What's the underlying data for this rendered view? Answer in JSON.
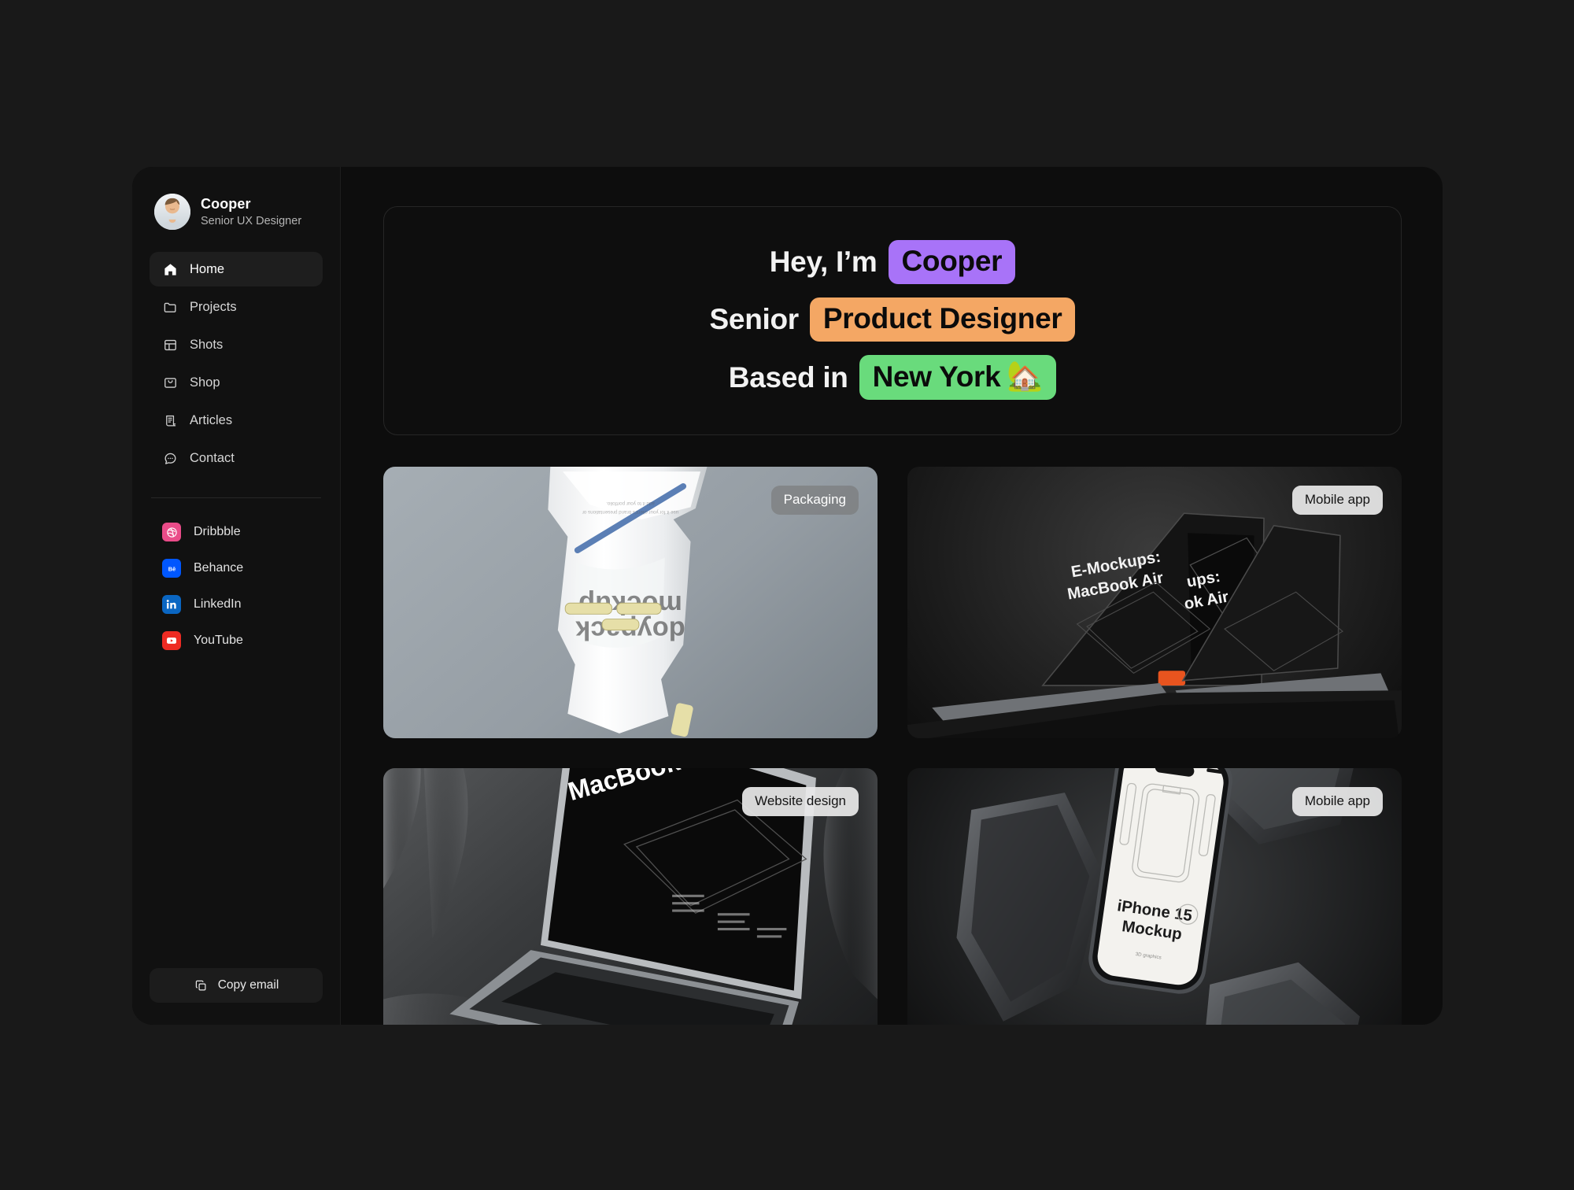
{
  "profile": {
    "name": "Cooper",
    "role": "Senior UX Designer",
    "avatar_icon": "user-avatar-photo"
  },
  "nav": {
    "items": [
      {
        "label": "Home",
        "icon": "home-icon",
        "active": true
      },
      {
        "label": "Projects",
        "icon": "folder-icon",
        "active": false
      },
      {
        "label": "Shots",
        "icon": "layout-icon",
        "active": false
      },
      {
        "label": "Shop",
        "icon": "shopping-bag-icon",
        "active": false
      },
      {
        "label": "Articles",
        "icon": "article-icon",
        "active": false
      },
      {
        "label": "Contact",
        "icon": "chat-bubble-icon",
        "active": false
      }
    ]
  },
  "socials": [
    {
      "label": "Dribbble",
      "icon": "dribbble-icon",
      "color": "#EA4C89"
    },
    {
      "label": "Behance",
      "icon": "behance-icon",
      "color": "#0057FF"
    },
    {
      "label": "LinkedIn",
      "icon": "linkedin-icon",
      "color": "#0A66C2"
    },
    {
      "label": "YouTube",
      "icon": "youtube-icon",
      "color": "#EE2B23"
    }
  ],
  "copy_email": {
    "label": "Copy email",
    "icon": "copy-icon"
  },
  "hero": {
    "line1_prefix": "Hey, I’m",
    "line1_chip": "Cooper",
    "line1_chip_color": "#A873F8",
    "line2_prefix": "Senior",
    "line2_chip": "Product Designer",
    "line2_chip_color": "#F4A764",
    "line3_prefix": "Based in",
    "line3_chip": "New York",
    "line3_chip_emoji": "🏡",
    "line3_chip_color": "#69DB7C"
  },
  "projects": [
    {
      "tag": "Packaging",
      "tag_style": "dark",
      "art": "doypack-pouch-mockup",
      "caption_text": "doypack mockup"
    },
    {
      "tag": "Mobile app",
      "tag_style": "light",
      "art": "macbook-pair-mockup",
      "caption_text": "E-Mockups: MacBook Air"
    },
    {
      "tag": "Website design",
      "tag_style": "light",
      "art": "macbook-silk-mockup",
      "caption_text": "E-Mockups: MacBook Air"
    },
    {
      "tag": "Mobile app",
      "tag_style": "light",
      "art": "iphone-rocks-mockup",
      "caption_text": "iPhone 15 Mockup"
    }
  ]
}
